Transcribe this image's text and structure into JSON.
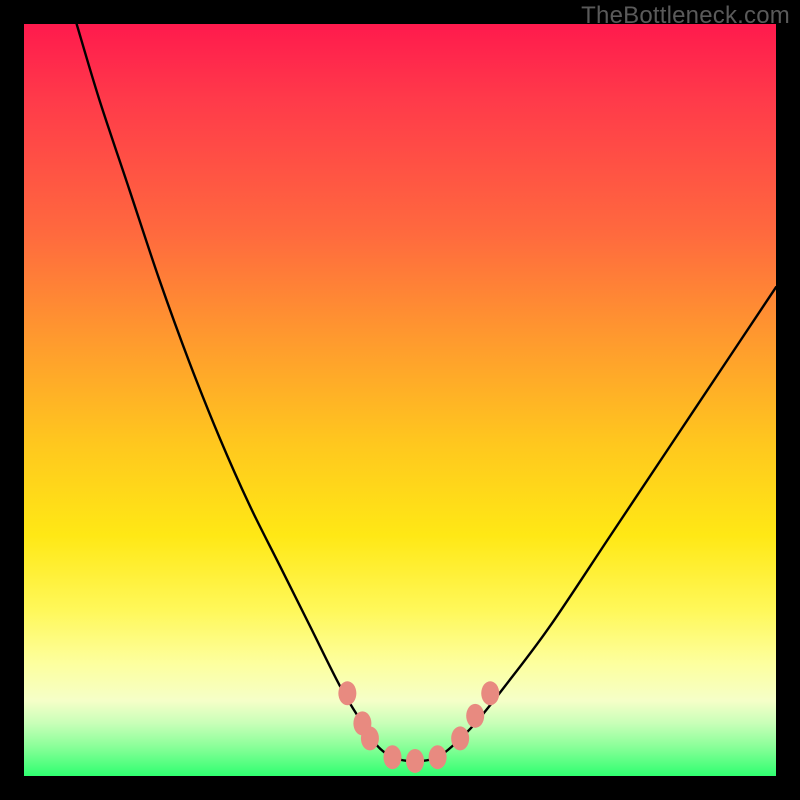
{
  "watermark": "TheBottleneck.com",
  "chart_data": {
    "type": "line",
    "title": "",
    "xlabel": "",
    "ylabel": "",
    "xlim": [
      0,
      100
    ],
    "ylim": [
      0,
      100
    ],
    "grid": false,
    "legend": false,
    "series": [
      {
        "name": "bottleneck-curve",
        "color": "#000000",
        "x": [
          7,
          10,
          14,
          18,
          22,
          26,
          30,
          34,
          38,
          42,
          45,
          47,
          49,
          51,
          53,
          55,
          57,
          60,
          64,
          70,
          78,
          86,
          94,
          100
        ],
        "y": [
          100,
          90,
          78,
          66,
          55,
          45,
          36,
          28,
          20,
          12,
          7,
          4,
          2.5,
          2,
          2,
          2.5,
          4,
          7,
          12,
          20,
          32,
          44,
          56,
          65
        ]
      }
    ],
    "markers": {
      "color": "#e88a80",
      "points": [
        {
          "x": 43,
          "y": 11
        },
        {
          "x": 45,
          "y": 7
        },
        {
          "x": 46,
          "y": 5
        },
        {
          "x": 49,
          "y": 2.5
        },
        {
          "x": 52,
          "y": 2
        },
        {
          "x": 55,
          "y": 2.5
        },
        {
          "x": 58,
          "y": 5
        },
        {
          "x": 60,
          "y": 8
        },
        {
          "x": 62,
          "y": 11
        }
      ]
    },
    "gradient_stops": [
      {
        "pos": 0,
        "color": "#ff1a4d"
      },
      {
        "pos": 28,
        "color": "#ff6a3e"
      },
      {
        "pos": 56,
        "color": "#ffc81e"
      },
      {
        "pos": 85,
        "color": "#fdff9e"
      },
      {
        "pos": 100,
        "color": "#2fff70"
      }
    ]
  }
}
